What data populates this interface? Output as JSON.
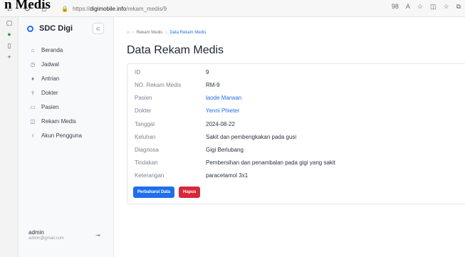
{
  "page_heading": "n Medis",
  "browser": {
    "url_prefix": "https://",
    "url_domain": "digimobile.info",
    "url_path": "/rekam_medis/9",
    "right_icons": [
      "98",
      "A",
      "☆",
      "◫",
      "☆",
      "⧉"
    ]
  },
  "sidebar": {
    "brand": "SDC Digi",
    "toggle_icon": "⊂",
    "items": [
      {
        "icon": "⌂",
        "label": "Beranda"
      },
      {
        "icon": "◷",
        "label": "Jadwal"
      },
      {
        "icon": "♦",
        "label": "Antrian"
      },
      {
        "icon": "⚕",
        "label": "Dokter"
      },
      {
        "icon": "▭",
        "label": "Pasien"
      },
      {
        "icon": "◫",
        "label": "Rekam Medis"
      },
      {
        "icon": "♀",
        "label": "Akun Pengguna"
      }
    ],
    "user": {
      "name": "admin",
      "email": "admin@gmail.com"
    }
  },
  "main": {
    "breadcrumb": {
      "home_icon": "⌂",
      "items": [
        "Rekam Medis",
        "Data Rekam Medis"
      ]
    },
    "title": "Data Rekam Medis",
    "fields": [
      {
        "label": "ID",
        "value": "9",
        "link": false
      },
      {
        "label": "NO. Rekam Medis",
        "value": "RM-9",
        "link": false
      },
      {
        "label": "Pasien",
        "value": "laode Marwan",
        "link": true
      },
      {
        "label": "Dokter",
        "value": "Yenni Phieter",
        "link": true
      },
      {
        "label": "Tanggal",
        "value": "2024-08-22",
        "link": false
      },
      {
        "label": "Keluhan",
        "value": "Sakit dan pembengkakan pada gusi",
        "link": false
      },
      {
        "label": "Diagnosa",
        "value": "Gigi Berlubang",
        "link": false
      },
      {
        "label": "Tindakan",
        "value": "Pembersihan dan penambalan pada gigi yang sakit",
        "link": false
      },
      {
        "label": "Keterangan",
        "value": "paracetamol 3x1",
        "link": false
      }
    ],
    "buttons": {
      "update": "Perbaharui Data",
      "delete": "Hapus"
    }
  },
  "colors": {
    "accent": "#1f6feb",
    "danger": "#d62839"
  }
}
